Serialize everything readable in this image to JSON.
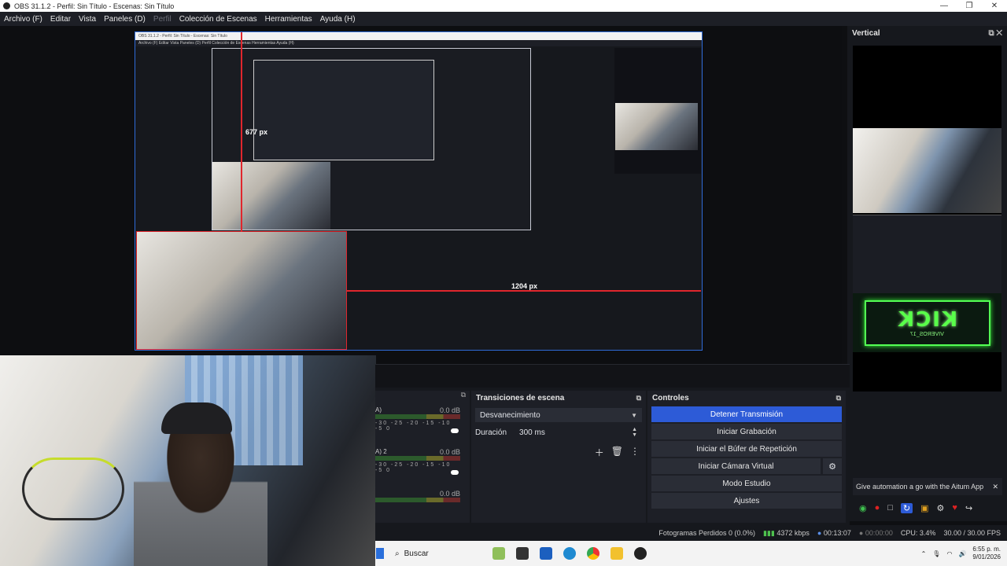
{
  "window": {
    "title": "OBS 31.1.2 - Perfil: Sin Título - Escenas: Sin Título",
    "minimize": "—",
    "maximize": "❐",
    "close": "✕"
  },
  "menu": {
    "items": [
      "Archivo (F)",
      "Editar",
      "Vista",
      "Paneles (D)",
      "Perfil",
      "Colección de Escenas",
      "Herramientas",
      "Ayuda (H)"
    ]
  },
  "preview": {
    "height_label": "677 px",
    "width_label": "1204 px",
    "nested_title": "OBS 31.1.2 - Perfil: Sin Título - Escenas: Sin Título",
    "nested_menu": "Archivo (F)   Editar   Vista   Paneles (D)   Perfil   Colección de Escenas   Herramientas   Ayuda (H)"
  },
  "vertical": {
    "title": "Vertical",
    "kick_text": "KICK",
    "kick_sub": "VIVEROS_17",
    "notification": "Give automation a go with the Aitum App"
  },
  "audio": {
    "meters": [
      {
        "label": "A)",
        "db": "0.0 dB"
      },
      {
        "label": "A) 2",
        "db": "0.0 dB"
      },
      {
        "label": "",
        "db": "0.0 dB"
      }
    ],
    "ticks": "-30 -25 -20 -15 -10 -5 0"
  },
  "transitions": {
    "title": "Transiciones de escena",
    "selected": "Desvanecimiento",
    "duration_label": "Duración",
    "duration_value": "300 ms"
  },
  "controls": {
    "title": "Controles",
    "stop_stream": "Detener Transmisión",
    "start_record": "Iniciar Grabación",
    "start_replay": "Iniciar el Búfer de Repetición",
    "start_vcam": "Iniciar Cámara Virtual",
    "studio_mode": "Modo Estudio",
    "settings": "Ajustes"
  },
  "status": {
    "dropped": "Fotogramas Perdidos 0 (0.0%)",
    "bitrate": "4372 kbps",
    "stream_time": "00:13:07",
    "record_time": "00:00:00",
    "cpu": "CPU: 3.4%",
    "fps": "30.00 / 30.00 FPS"
  },
  "taskbar": {
    "search": "Buscar",
    "time": "6:55 p. m.",
    "date": "9/01/2026"
  },
  "colors": {
    "accent": "#2d5bd7",
    "selection": "#e0262d",
    "kick_green": "#54ff54"
  }
}
